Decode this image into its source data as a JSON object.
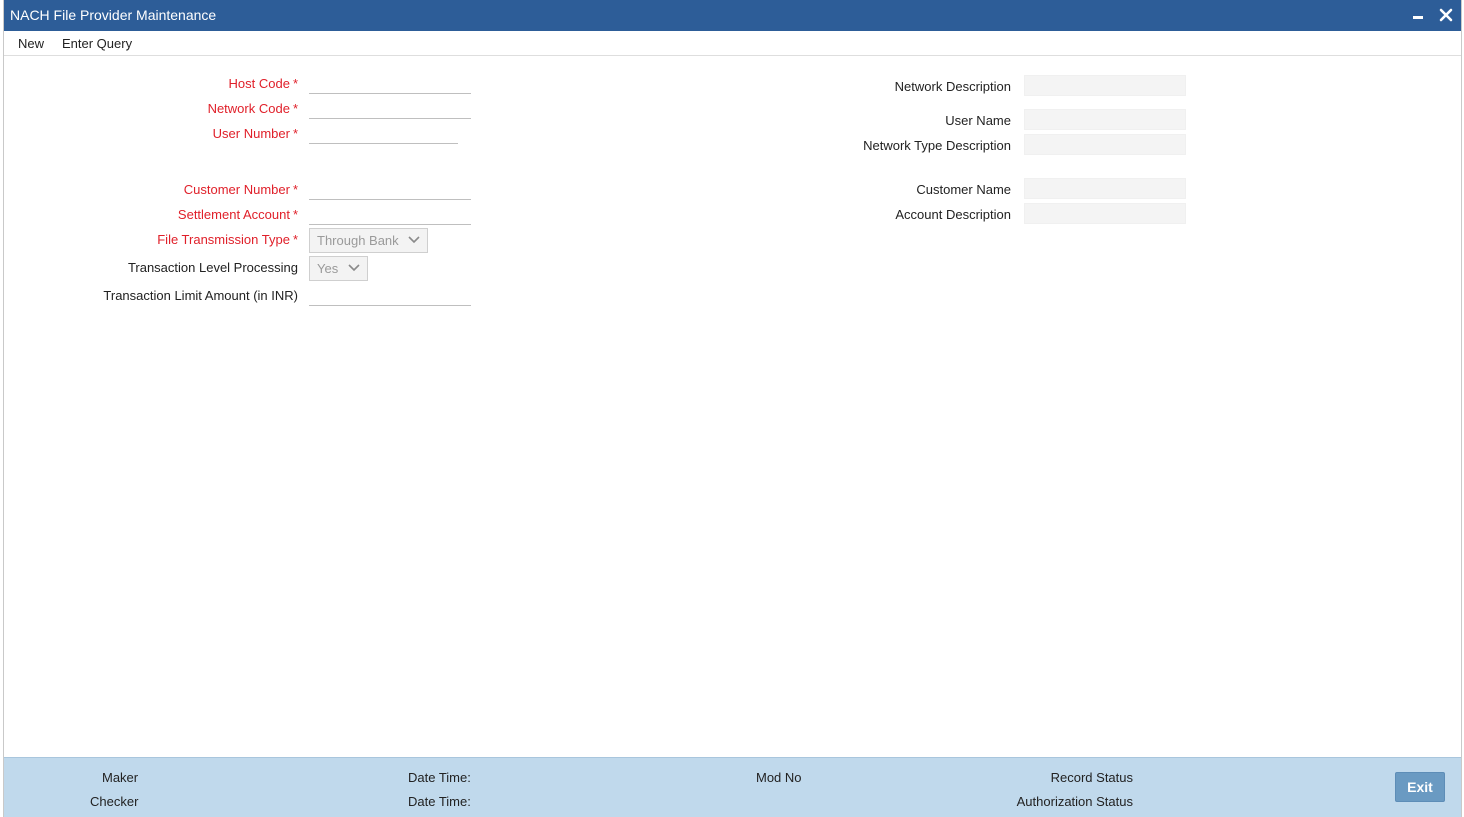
{
  "window": {
    "title": "NACH File Provider Maintenance"
  },
  "menu": {
    "new_label": "New",
    "enter_query_label": "Enter Query"
  },
  "left_form": {
    "host_code": {
      "label": "Host Code",
      "value": "",
      "required": true
    },
    "network_code": {
      "label": "Network Code",
      "value": "",
      "required": true
    },
    "user_number": {
      "label": "User Number",
      "value": "",
      "required": true
    },
    "customer_number": {
      "label": "Customer Number",
      "value": "",
      "required": true
    },
    "settlement_account": {
      "label": "Settlement Account",
      "value": "",
      "required": true
    },
    "file_transmission_type": {
      "label": "File Transmission Type",
      "value": "Through Bank",
      "required": true
    },
    "transaction_level_processing": {
      "label": "Transaction Level Processing",
      "value": "Yes",
      "required": false
    },
    "transaction_limit_amount": {
      "label": "Transaction Limit Amount (in INR)",
      "value": "",
      "required": false
    }
  },
  "right_form": {
    "network_description": {
      "label": "Network Description",
      "value": ""
    },
    "user_name": {
      "label": "User Name",
      "value": ""
    },
    "network_type_description": {
      "label": "Network Type Description",
      "value": ""
    },
    "customer_name": {
      "label": "Customer Name",
      "value": ""
    },
    "account_description": {
      "label": "Account Description",
      "value": ""
    }
  },
  "footer": {
    "maker_label": "Maker",
    "checker_label": "Checker",
    "date_time_label_1": "Date Time:",
    "date_time_label_2": "Date Time:",
    "mod_no_label": "Mod No",
    "record_status_label": "Record Status",
    "authorization_status_label": "Authorization Status",
    "exit_label": "Exit"
  },
  "colors": {
    "titlebar": "#2d5d98",
    "required_label": "#e0202a",
    "footer_bg": "#c0d9ec",
    "exit_button": "#6a9ac2"
  },
  "required_marker": "*"
}
